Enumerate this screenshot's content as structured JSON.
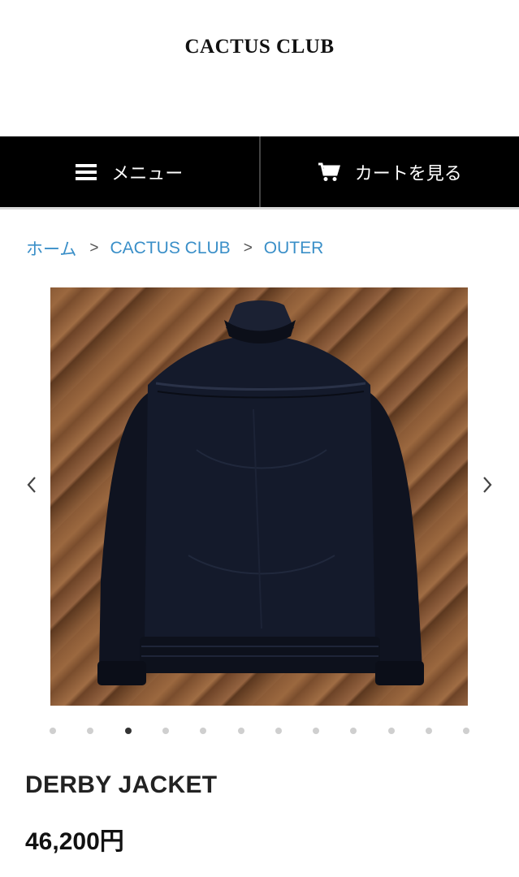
{
  "header": {
    "logo": "CACTUS CLUB"
  },
  "nav": {
    "menu_label": "メニュー",
    "menu_icon": "hamburger-icon",
    "cart_label": "カートを見る",
    "cart_icon": "cart-icon"
  },
  "breadcrumb": {
    "items": [
      "ホーム",
      "CACTUS CLUB",
      "OUTER"
    ],
    "separator": ">"
  },
  "carousel": {
    "image_description_icon": "jacket-photo",
    "prev_icon": "chevron-left-icon",
    "next_icon": "chevron-right-icon",
    "slide_count": 12,
    "active_index": 2
  },
  "product": {
    "title": "DERBY JACKET",
    "price": "46,200円"
  },
  "colors": {
    "nav_bg": "#000000",
    "link": "#3a8fc8",
    "dot_active": "#333333",
    "dot_inactive": "#cfcfcf"
  }
}
